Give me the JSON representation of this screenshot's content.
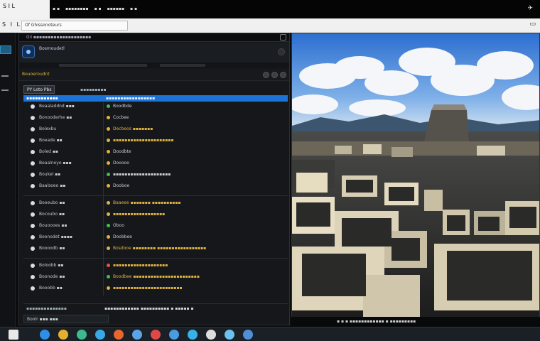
{
  "topbar": {
    "tab_text": "S I L",
    "items": [
      "▪ ▪",
      "▪▪▪▪▪▪▪▪",
      "▪ ▪",
      "▪▪▪▪▪▪",
      "▪ ▪"
    ],
    "right_icon": "✈"
  },
  "address": {
    "left_text": "S I L",
    "field_text": "Of Ghissonoteurs",
    "right_icon": "window-icon"
  },
  "window": {
    "title": "Gii ▪▪▪▪▪▪▪▪▪▪▪▪▪▪▪▪▪▪▪▪",
    "header_title": "Bosmoudetl",
    "toolbar_label": "Bouoeroudnt",
    "tab_label": "PY Loto Pbs",
    "tab2_label": "▪▪▪▪▪▪▪▪▪",
    "selected_row_left": "▪▪▪▪▪▪▪▪▪▪▪",
    "selected_row_right": "▪▪▪▪▪▪▪▪▪▪▪▪▪▪▪▪▪",
    "rows": [
      {
        "label": "Beaaladdnd ▪▪▪",
        "value": "Boodbde",
        "dot": "#3fbf55",
        "value_color": "#c8ccd2"
      },
      {
        "label": "Bonooderhe ▪▪",
        "value": "Cocbee",
        "dot": "#e0b341",
        "value_color": "#c8ccd2"
      },
      {
        "label": "Bolexbu",
        "value": "Decbeos ▪▪▪▪▪▪▪",
        "dot": "#e0b341",
        "value_color": "#e0b341"
      },
      {
        "label": "Boeade ▪▪",
        "value": "▪▪▪▪▪▪▪▪▪▪▪▪▪▪▪▪▪▪▪▪▪",
        "dot": "#e0b341",
        "value_color": "#e0b341"
      },
      {
        "label": "Boled ▪▪",
        "value": "Doodbte",
        "dot": "#e0b341",
        "value_color": "#c8ccd2"
      },
      {
        "label": "Beaalnoyo ▪▪▪",
        "value": "Dooooo",
        "dot": "#e0b341",
        "value_color": "#c8ccd2"
      },
      {
        "label": "Boukel ▪▪",
        "value": "▪▪▪▪▪▪▪▪▪▪▪▪▪▪▪▪▪▪▪▪",
        "dot": "#3fbf55",
        "value_color": "#c8ccd2"
      },
      {
        "label": "Baalsoeo ▪▪",
        "value": "Dooboe",
        "dot": "#e0b341",
        "value_color": "#c8ccd2"
      },
      {
        "label": "Booeubo ▪▪",
        "value": "Baaeee ▪▪▪▪▪▪▪ ▪▪▪▪▪▪▪▪▪▪",
        "dot": "#e0b341",
        "value_color": "#e0b341"
      },
      {
        "label": "Bocoubo ▪▪",
        "value": "▪▪▪▪▪▪▪▪▪▪▪▪▪▪▪▪▪▪",
        "dot": "#e0b341",
        "value_color": "#e0b341"
      },
      {
        "label": "Bouoooes ▪▪",
        "value": "Oboo",
        "dot": "#3fbf55",
        "value_color": "#c8ccd2"
      },
      {
        "label": "Boonodet ▪▪▪▪",
        "value": "Doobbee",
        "dot": "#e0b341",
        "value_color": "#c8ccd2"
      },
      {
        "label": "Boooodb ▪▪",
        "value": "Bosdooe ▪▪▪▪▪▪▪▪ ▪▪▪▪▪▪▪▪▪▪▪▪▪▪▪▪▪",
        "dot": "#e0b341",
        "value_color": "#e0b341"
      },
      {
        "label": "Boloobb ▪▪",
        "value": "▪▪▪▪▪▪▪▪▪▪▪▪▪▪▪▪▪▪▪",
        "dot": "#e05a3a",
        "value_color": "#e0b341"
      },
      {
        "label": "Boonode ▪▪",
        "value": "Boodbee ▪▪▪▪▪▪▪▪▪▪▪▪▪▪▪▪▪▪▪▪▪▪▪",
        "dot": "#3fbf55",
        "value_color": "#e0b341"
      },
      {
        "label": "Booobb ▪▪",
        "value": "▪▪▪▪▪▪▪▪▪▪▪▪▪▪▪▪▪▪▪▪▪▪▪▪",
        "dot": "#e0b341",
        "value_color": "#e0b341"
      }
    ],
    "status_left": "▪▪▪▪▪▪▪▪▪▪▪▪▪▪",
    "status_right": "▪▪▪▪▪▪▪▪▪▪▪▪ ▪▪▪▪▪▪▪▪▪▪ ▪ ▪▪▪▪▪ ▪",
    "footer_label": "Boolr ▪▪▪ ▪▪▪"
  },
  "viewport_bar": "▪ ▪ ▪ ▪▪▪▪▪▪▪▪▪▪▪▪ ▪ ▪▪▪▪▪▪▪▪▪",
  "taskbar_icons": [
    {
      "name": "browser-icon",
      "color": "#2f8fe6"
    },
    {
      "name": "folder-icon",
      "color": "#e6b02f"
    },
    {
      "name": "app-icon",
      "color": "#3dbb8f"
    },
    {
      "name": "chat-icon",
      "color": "#3aa7e6"
    },
    {
      "name": "game-icon",
      "color": "#e6662f"
    },
    {
      "name": "store-icon",
      "color": "#58a6e8"
    },
    {
      "name": "mail-icon",
      "color": "#e04848"
    },
    {
      "name": "media-icon",
      "color": "#4a9be0"
    },
    {
      "name": "cloud-icon",
      "color": "#38b0e8"
    },
    {
      "name": "share-icon",
      "color": "#ddd"
    },
    {
      "name": "arrow-icon",
      "color": "#6ac2f0"
    },
    {
      "name": "edit-icon",
      "color": "#4f8fd8"
    }
  ]
}
